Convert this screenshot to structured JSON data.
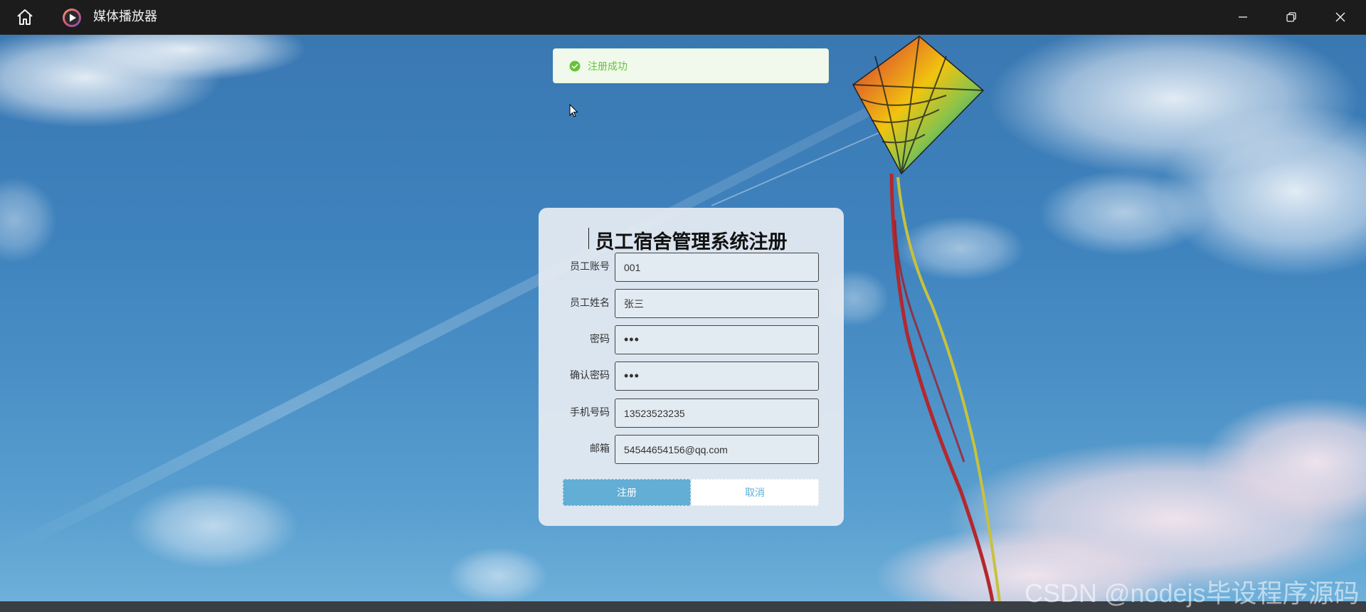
{
  "window": {
    "title": "媒体播放器"
  },
  "toast": {
    "message": "注册成功",
    "color": "#67c23a"
  },
  "form": {
    "title": "员工宿舍管理系统注册",
    "fields": [
      {
        "label": "员工账号",
        "value": "001"
      },
      {
        "label": "员工姓名",
        "value": "张三"
      },
      {
        "label": "密码",
        "value": "•••"
      },
      {
        "label": "确认密码",
        "value": "•••"
      },
      {
        "label": "手机号码",
        "value": "13523523235"
      },
      {
        "label": "邮箱",
        "value": "54544654156@qq.com"
      }
    ],
    "register_label": "注册",
    "cancel_label": "取消",
    "accent": "#62aed4"
  },
  "watermark": "CSDN @nodejs毕设程序源码",
  "icons": {
    "home": "home-icon",
    "logo": "media-player-logo-icon",
    "minimize": "minimize-icon",
    "maximize": "restore-icon",
    "close": "close-icon",
    "success": "check-circle-icon"
  }
}
